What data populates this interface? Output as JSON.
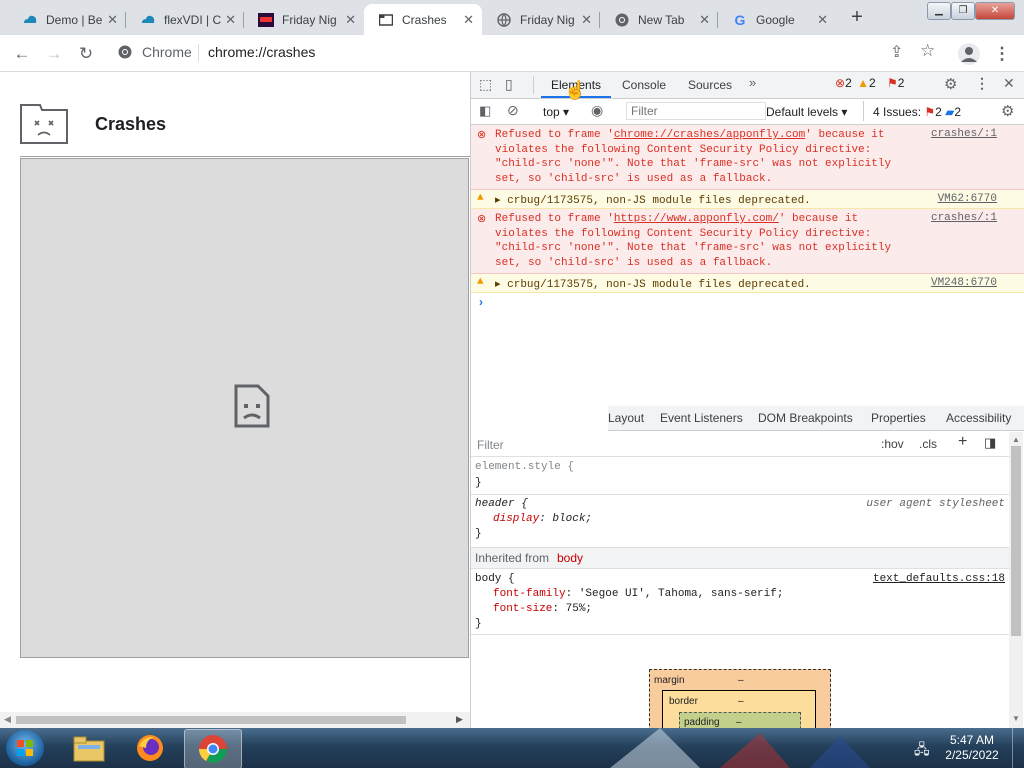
{
  "tabs": [
    {
      "title": "Demo | Be",
      "icon": "cloud-icon"
    },
    {
      "title": "flexVDI | C",
      "icon": "cloud-icon"
    },
    {
      "title": "Friday Nig",
      "icon": "friday-night-icon"
    },
    {
      "title": "Crashes",
      "icon": "crashes-icon",
      "active": true
    },
    {
      "title": "Friday Nig",
      "icon": "globe-icon"
    },
    {
      "title": "New Tab",
      "icon": "chrome-icon"
    },
    {
      "title": "Google",
      "icon": "google-icon"
    }
  ],
  "toolbar": {
    "site_label": "Chrome",
    "url": "chrome://crashes"
  },
  "page": {
    "title": "Crashes"
  },
  "devtools": {
    "tabs": [
      "Elements",
      "Console",
      "Sources"
    ],
    "active_tab": "Elements",
    "counts": {
      "errors": "2",
      "warnings": "2",
      "issues": "2"
    },
    "console_bar": {
      "context": "top",
      "filter_placeholder": "Filter",
      "levels": "Default levels",
      "issues_label": "4 Issues:",
      "issues_err": "2",
      "issues_info": "2"
    },
    "messages": [
      {
        "type": "error",
        "pre": "Refused to frame '",
        "link": "chrome://crashes/apponfly.com",
        "post": "' because it violates the following Content Security Policy directive: \"child-src 'none'\". Note that 'frame-src' was not explicitly set, so 'child-src' is used as a fallback.",
        "source": "crashes/:1"
      },
      {
        "type": "warning",
        "text": "crbug/1173575, non-JS module files deprecated.",
        "source": "VM62:6770"
      },
      {
        "type": "error",
        "pre": "Refused to frame '",
        "link": "https://www.apponfly.com/",
        "post": "' because it violates the following Content Security Policy directive: \"child-src 'none'\". Note that 'frame-src' was not explicitly set, so 'child-src' is used as a fallback.",
        "source": "crashes/:1"
      },
      {
        "type": "warning",
        "text": "crbug/1173575, non-JS module files deprecated.",
        "source": "VM248:6770"
      }
    ],
    "styles_tabs": [
      "Layout",
      "Event Listeners",
      "DOM Breakpoints",
      "Properties",
      "Accessibility"
    ],
    "styles_filter": "Filter",
    "hov": ":hov",
    "cls": ".cls",
    "rules": {
      "element_style": "element.style {",
      "close": "}",
      "header_selector": "header {",
      "header_origin": "user agent stylesheet",
      "header_prop": "display",
      "header_val": "block;",
      "inherited_label": "Inherited from",
      "inherited_from": "body",
      "body_selector": "body {",
      "body_source": "text_defaults.css:18",
      "body_prop1": "font-family",
      "body_val1": "'Segoe UI', Tahoma, sans-serif;",
      "body_prop2": "font-size",
      "body_val2": "75%;"
    },
    "box_model": {
      "margin": "margin",
      "margin_val": "–",
      "border": "border",
      "border_val": "–",
      "padding": "padding",
      "padding_val": "–"
    }
  },
  "taskbar": {
    "time": "5:47 AM",
    "date": "2/25/2022"
  },
  "colors": {
    "error": "#d93025",
    "warning_bg": "#fefbe4",
    "accent": "#1a73e8"
  }
}
